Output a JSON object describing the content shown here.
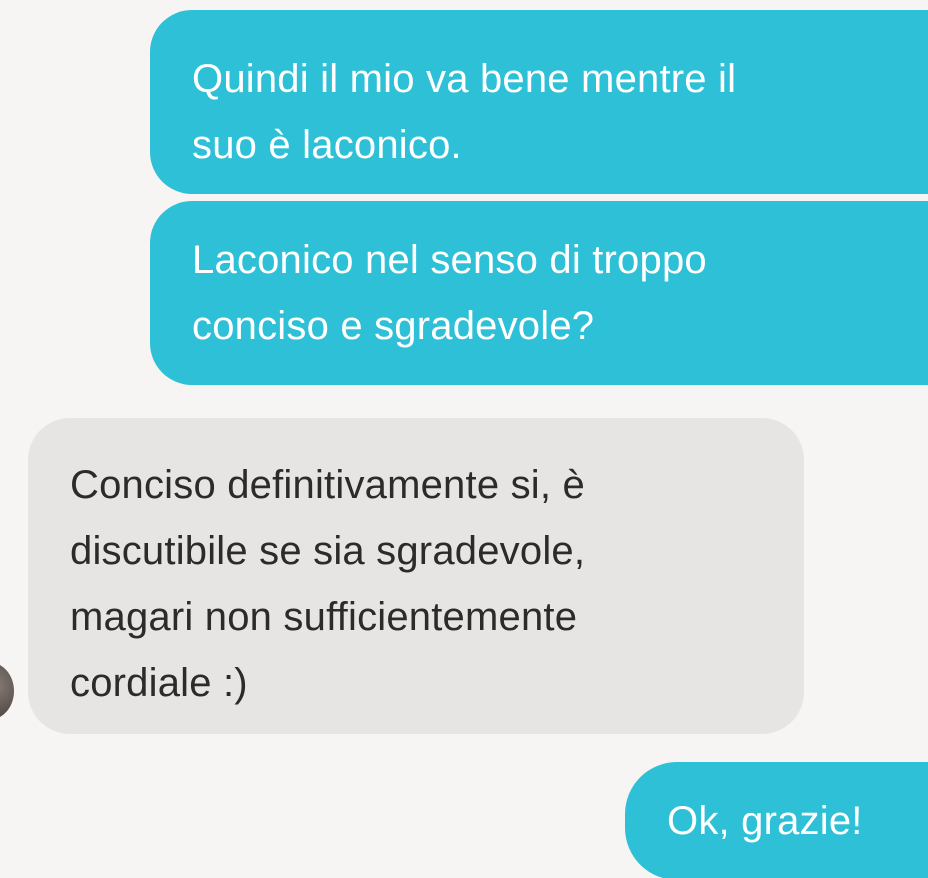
{
  "messages": [
    {
      "direction": "outgoing",
      "lines": [
        "Quindi il mio va bene mentre il",
        "suo è laconico."
      ]
    },
    {
      "direction": "outgoing",
      "lines": [
        "Laconico nel senso di troppo",
        "conciso e sgradevole?"
      ]
    },
    {
      "direction": "incoming",
      "lines": [
        "Conciso definitivamente si, è",
        "discutibile se sia sgradevole,",
        "magari non sufficientemente",
        "cordiale :)"
      ]
    },
    {
      "direction": "outgoing",
      "lines": [
        "Ok, grazie!"
      ]
    }
  ],
  "colors": {
    "outgoing_bubble": "#2dc0d7",
    "incoming_bubble": "#e7e5e3",
    "background": "#f6f5f3"
  }
}
